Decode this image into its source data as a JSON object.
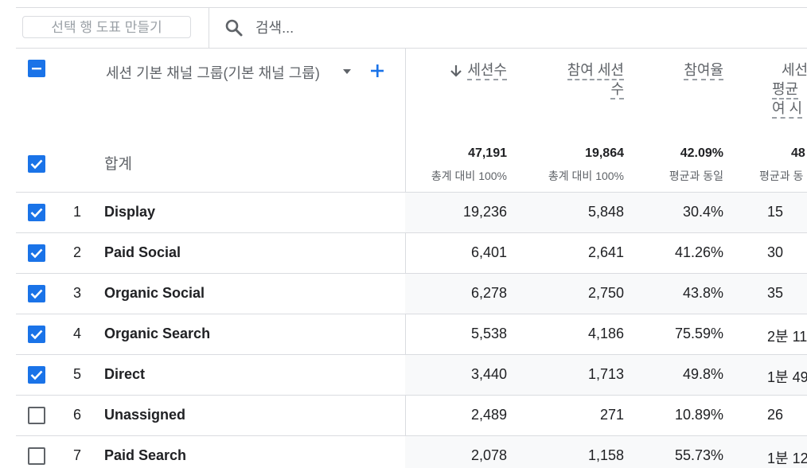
{
  "toolbar": {
    "plot_button_label": "선택 행 도표 만들기",
    "search_placeholder": "검색..."
  },
  "dimension": {
    "label": "세션 기본 채널 그룹(기본 채널 그룹)"
  },
  "metrics": {
    "sessions": "세션수",
    "engaged_sessions_line1": "참여 세션",
    "engaged_sessions_line2": "수",
    "engagement_rate": "참여율",
    "avg_line1": "세선",
    "avg_line2": "평균",
    "avg_line3": "여 시"
  },
  "totals": {
    "label": "합계",
    "sessions": "47,191",
    "sessions_sub": "총계 대비 100%",
    "engaged": "19,864",
    "engaged_sub": "총계 대비 100%",
    "rate": "42.09%",
    "rate_sub": "평균과 동일",
    "avg": "48",
    "avg_sub": "평균과 동"
  },
  "rows": [
    {
      "idx": "1",
      "name": "Display",
      "sessions": "19,236",
      "engaged": "5,848",
      "rate": "30.4%",
      "avg": "15",
      "checked": true
    },
    {
      "idx": "2",
      "name": "Paid Social",
      "sessions": "6,401",
      "engaged": "2,641",
      "rate": "41.26%",
      "avg": "30",
      "checked": true
    },
    {
      "idx": "3",
      "name": "Organic Social",
      "sessions": "6,278",
      "engaged": "2,750",
      "rate": "43.8%",
      "avg": "35",
      "checked": true
    },
    {
      "idx": "4",
      "name": "Organic Search",
      "sessions": "5,538",
      "engaged": "4,186",
      "rate": "75.59%",
      "avg": "2분 11",
      "checked": true
    },
    {
      "idx": "5",
      "name": "Direct",
      "sessions": "3,440",
      "engaged": "1,713",
      "rate": "49.8%",
      "avg": "1분 49",
      "checked": true
    },
    {
      "idx": "6",
      "name": "Unassigned",
      "sessions": "2,489",
      "engaged": "271",
      "rate": "10.89%",
      "avg": "26",
      "checked": false
    },
    {
      "idx": "7",
      "name": "Paid Search",
      "sessions": "2,078",
      "engaged": "1,158",
      "rate": "55.73%",
      "avg": "1분 12",
      "checked": false
    }
  ],
  "colors": {
    "accent": "#1a73e8",
    "row_shade": "#f8f9fa",
    "divider": "#dadce0"
  },
  "icons": {
    "search": "search-icon",
    "sort": "arrow-down-icon",
    "caret": "caret-down-icon",
    "add": "plus-icon"
  }
}
